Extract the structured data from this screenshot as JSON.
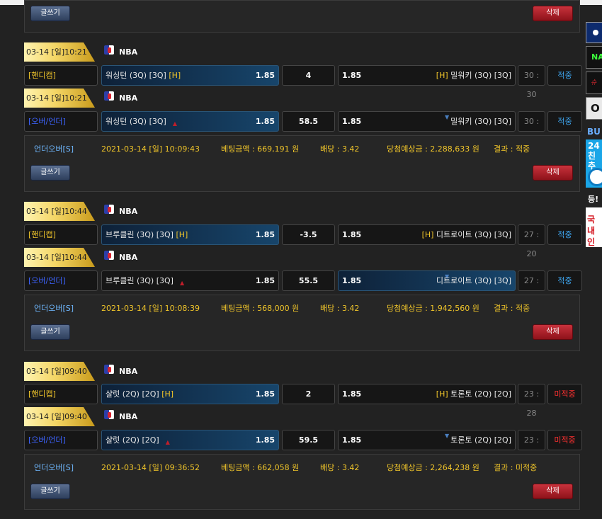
{
  "buttons": {
    "write": "글쓰기",
    "delete": "삭제"
  },
  "league_icon": "nba-logo-icon",
  "groups": [
    {
      "bets": [
        {
          "date": "03-14 [일]10:21",
          "league": "NBA",
          "type": "[핸디캡]",
          "home": "워싱턴 (3Q) [3Q]",
          "home_tag": "[H]",
          "home_odds": "1.85",
          "line": "4",
          "away_odds": "1.85",
          "away_tag": "[H]",
          "away": "밀워키 (3Q) [3Q]",
          "score": "30 : 30",
          "result": "적중"
        },
        {
          "date": "03-14 [일]10:21",
          "league": "NBA",
          "type": "[오버/언더]",
          "home": "워싱턴 (3Q) [3Q]",
          "home_tag": "",
          "home_odds": "1.85",
          "line": "58.5",
          "away_odds": "1.85",
          "away_tag": "",
          "away": "밀워키 (3Q) [3Q]",
          "score": "30 : 30",
          "result": "적중"
        }
      ],
      "summary": {
        "category": "언더오버[S]",
        "date": "2021-03-14 [일] 10:09:43",
        "bet_amount": "베팅금액 : 669,191 원",
        "odds": "배당 : 3.42",
        "expected": "당첨예상금 : 2,288,633 원",
        "result": "결과 : 적중"
      }
    },
    {
      "bets": [
        {
          "date": "03-14 [일]10:44",
          "league": "NBA",
          "type": "[핸디캡]",
          "home": "브루클린 (3Q) [3Q]",
          "home_tag": "[H]",
          "home_odds": "1.85",
          "line": "-3.5",
          "away_odds": "1.85",
          "away_tag": "[H]",
          "away": "디트로이트 (3Q) [3Q]",
          "score": "27 : 20",
          "result": "적중"
        },
        {
          "date": "03-14 [일]10:44",
          "league": "NBA",
          "type": "[오버/언더]",
          "home": "브루클린 (3Q) [3Q]",
          "home_tag": "",
          "home_odds": "1.85",
          "line": "55.5",
          "away_odds": "1.85",
          "away_tag": "",
          "away": "디트로이트 (3Q) [3Q]",
          "score": "27 : 20",
          "result": "적중"
        }
      ],
      "summary": {
        "category": "언더오버[S]",
        "date": "2021-03-14 [일] 10:08:39",
        "bet_amount": "베팅금액 : 568,000 원",
        "odds": "배당 : 3.42",
        "expected": "당첨예상금 : 1,942,560 원",
        "result": "결과 : 적중"
      }
    },
    {
      "bets": [
        {
          "date": "03-14 [일]09:40",
          "league": "NBA",
          "type": "[핸디캡]",
          "home": "샬럿 (2Q) [2Q]",
          "home_tag": "[H]",
          "home_odds": "1.85",
          "line": "2",
          "away_odds": "1.85",
          "away_tag": "[H]",
          "away": "토론토 (2Q) [2Q]",
          "score": "23 : 28",
          "result": "미적중"
        },
        {
          "date": "03-14 [일]09:40",
          "league": "NBA",
          "type": "[오버/언더]",
          "home": "샬럿 (2Q) [2Q]",
          "home_tag": "",
          "home_odds": "1.85",
          "line": "59.5",
          "away_odds": "1.85",
          "away_tag": "",
          "away": "토론토 (2Q) [2Q]",
          "score": "23 : 28",
          "result": "미적중"
        }
      ],
      "summary": {
        "category": "언더오버[S]",
        "date": "2021-03-14 [일] 09:36:52",
        "bet_amount": "베팅금액 : 662,058 원",
        "odds": "배당 : 3.42",
        "expected": "당첨예상금 : 2,264,238 원",
        "result": "결과 : 미적중"
      }
    }
  ],
  "sidebar": {
    "banner2": "NA",
    "banner3": "슈퍼",
    "banner4": "O",
    "banner5": "BU",
    "banner6_line1": "24",
    "banner6_line2": "친추",
    "banner7": "등!",
    "banner8_line1": "국내",
    "banner8_line2": "인증"
  }
}
